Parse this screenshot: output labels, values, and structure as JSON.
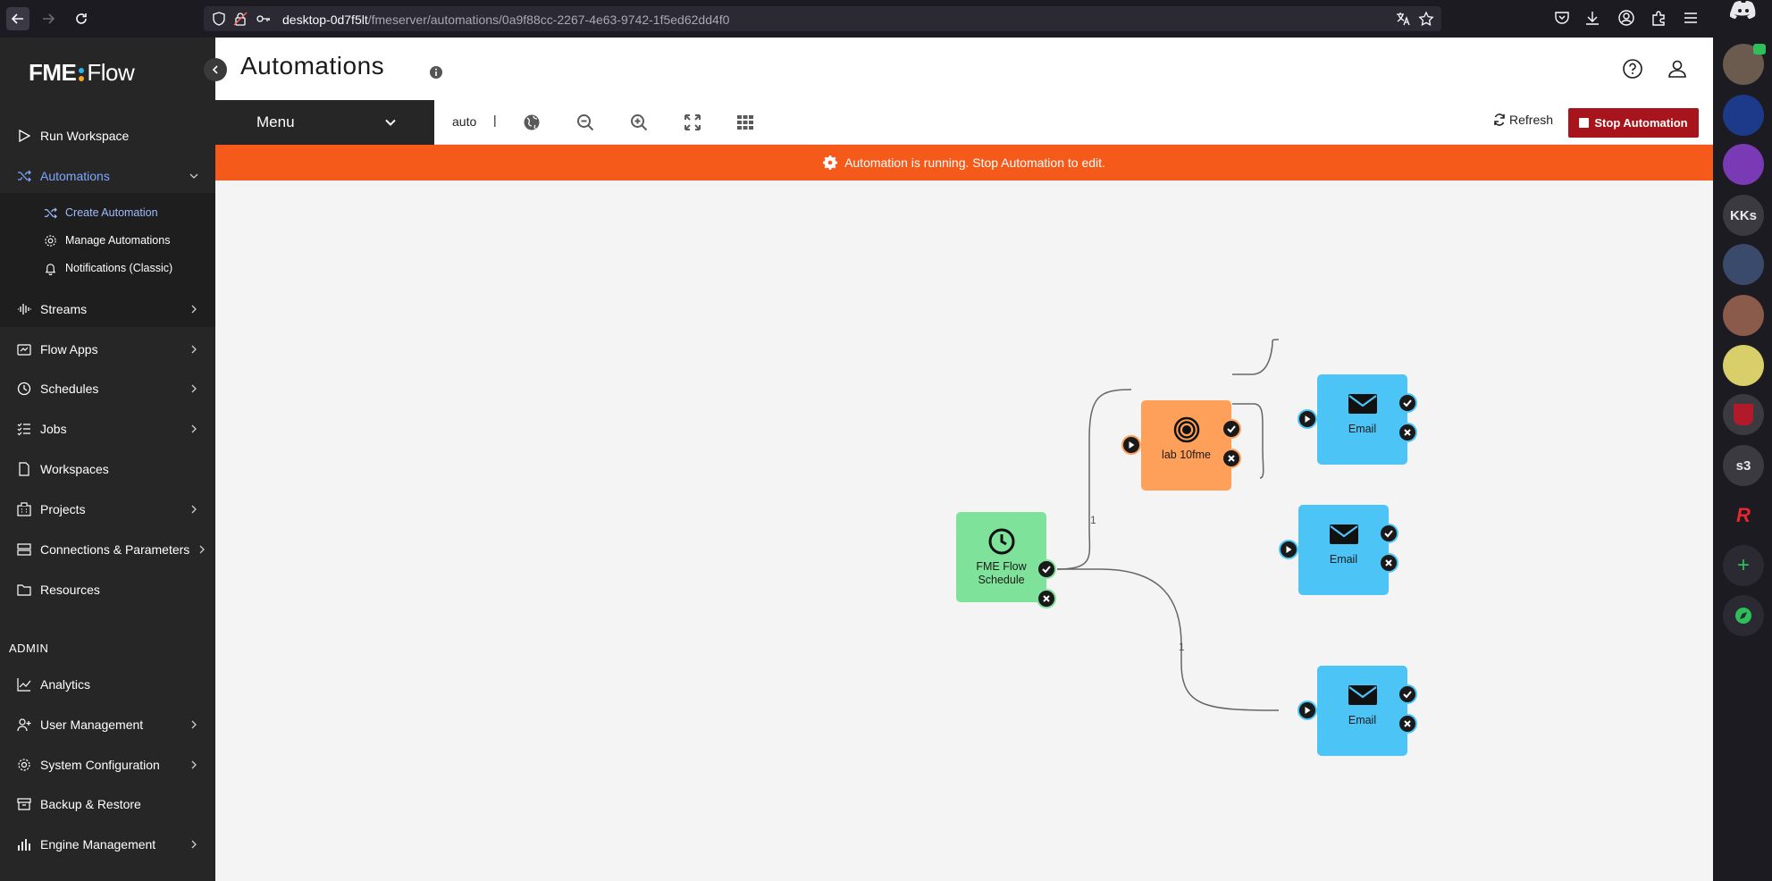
{
  "browser": {
    "url_host": "desktop-0d7f5lt",
    "url_path": "/fmeserver/automations/0a9f88cc-2267-4e63-9742-1f5ed62dd4f0"
  },
  "right_rail": {
    "items": [
      "",
      "",
      "",
      "KKs",
      "",
      "",
      "",
      "",
      "s3",
      "R",
      "+",
      ""
    ]
  },
  "sidebar": {
    "logo_fme": "FME",
    "logo_flow": "Flow",
    "items": [
      {
        "label": "Run Workspace"
      },
      {
        "label": "Automations"
      },
      {
        "label": "Streams"
      },
      {
        "label": "Flow Apps"
      },
      {
        "label": "Schedules"
      },
      {
        "label": "Jobs"
      },
      {
        "label": "Workspaces"
      },
      {
        "label": "Projects"
      },
      {
        "label": "Connections & Parameters"
      },
      {
        "label": "Resources"
      }
    ],
    "sub_items": [
      {
        "label": "Create Automation"
      },
      {
        "label": "Manage Automations"
      },
      {
        "label": "Notifications (Classic)"
      }
    ],
    "admin_label": "ADMIN",
    "admin_items": [
      {
        "label": "Analytics"
      },
      {
        "label": "User Management"
      },
      {
        "label": "System Configuration"
      },
      {
        "label": "Backup & Restore"
      },
      {
        "label": "Engine Management"
      }
    ]
  },
  "header": {
    "title": "Automations"
  },
  "toolbar": {
    "menu_label": "Menu",
    "layout_value": "auto",
    "separator": "|",
    "refresh_label": "Refresh",
    "stop_label": "Stop Automation"
  },
  "banner": {
    "text": "Automation is running. Stop Automation to edit."
  },
  "canvas": {
    "nodes": [
      {
        "label_line1": "FME Flow",
        "label_line2": "Schedule",
        "color": "#7ee29a"
      },
      {
        "label_line1": "lab 10fme",
        "label_line2": "",
        "color": "#ffa05a"
      },
      {
        "label_line1": "Email",
        "label_line2": "",
        "color": "#4cc4f5"
      },
      {
        "label_line1": "Email",
        "label_line2": "",
        "color": "#4cc4f5"
      },
      {
        "label_line1": "Email",
        "label_line2": "",
        "color": "#4cc4f5"
      }
    ],
    "connection_labels": [
      "1",
      "1"
    ]
  },
  "colors": {
    "sidebar_bg": "#262626",
    "active_blue": "#7ea7ff",
    "banner_orange": "#f55a1a",
    "stop_red": "#a8141c",
    "trigger_green": "#7ee29a",
    "action_orange": "#ffa05a",
    "email_blue": "#4cc4f5"
  }
}
